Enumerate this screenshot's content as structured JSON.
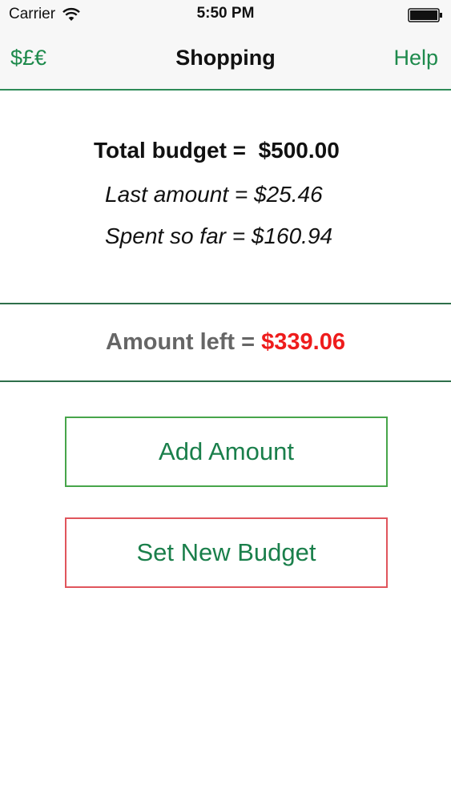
{
  "status_bar": {
    "carrier": "Carrier",
    "time": "5:50 PM",
    "icons": [
      "wifi-icon",
      "battery-icon"
    ]
  },
  "nav": {
    "left_label": "$£€",
    "title": "Shopping",
    "right_label": "Help",
    "accent_color": "#1e8a4c"
  },
  "summary": {
    "total_label": "Total budget =",
    "total_value": "$500.00",
    "last_label": "Last amount =",
    "last_value": "$25.46",
    "spent_label": "Spent so far =",
    "spent_value": "$160.94"
  },
  "amount_left": {
    "label": "Amount left =",
    "value": "$339.06",
    "value_color": "#ee1c1c"
  },
  "buttons": {
    "add_amount": "Add Amount",
    "set_new_budget": "Set New Budget"
  }
}
